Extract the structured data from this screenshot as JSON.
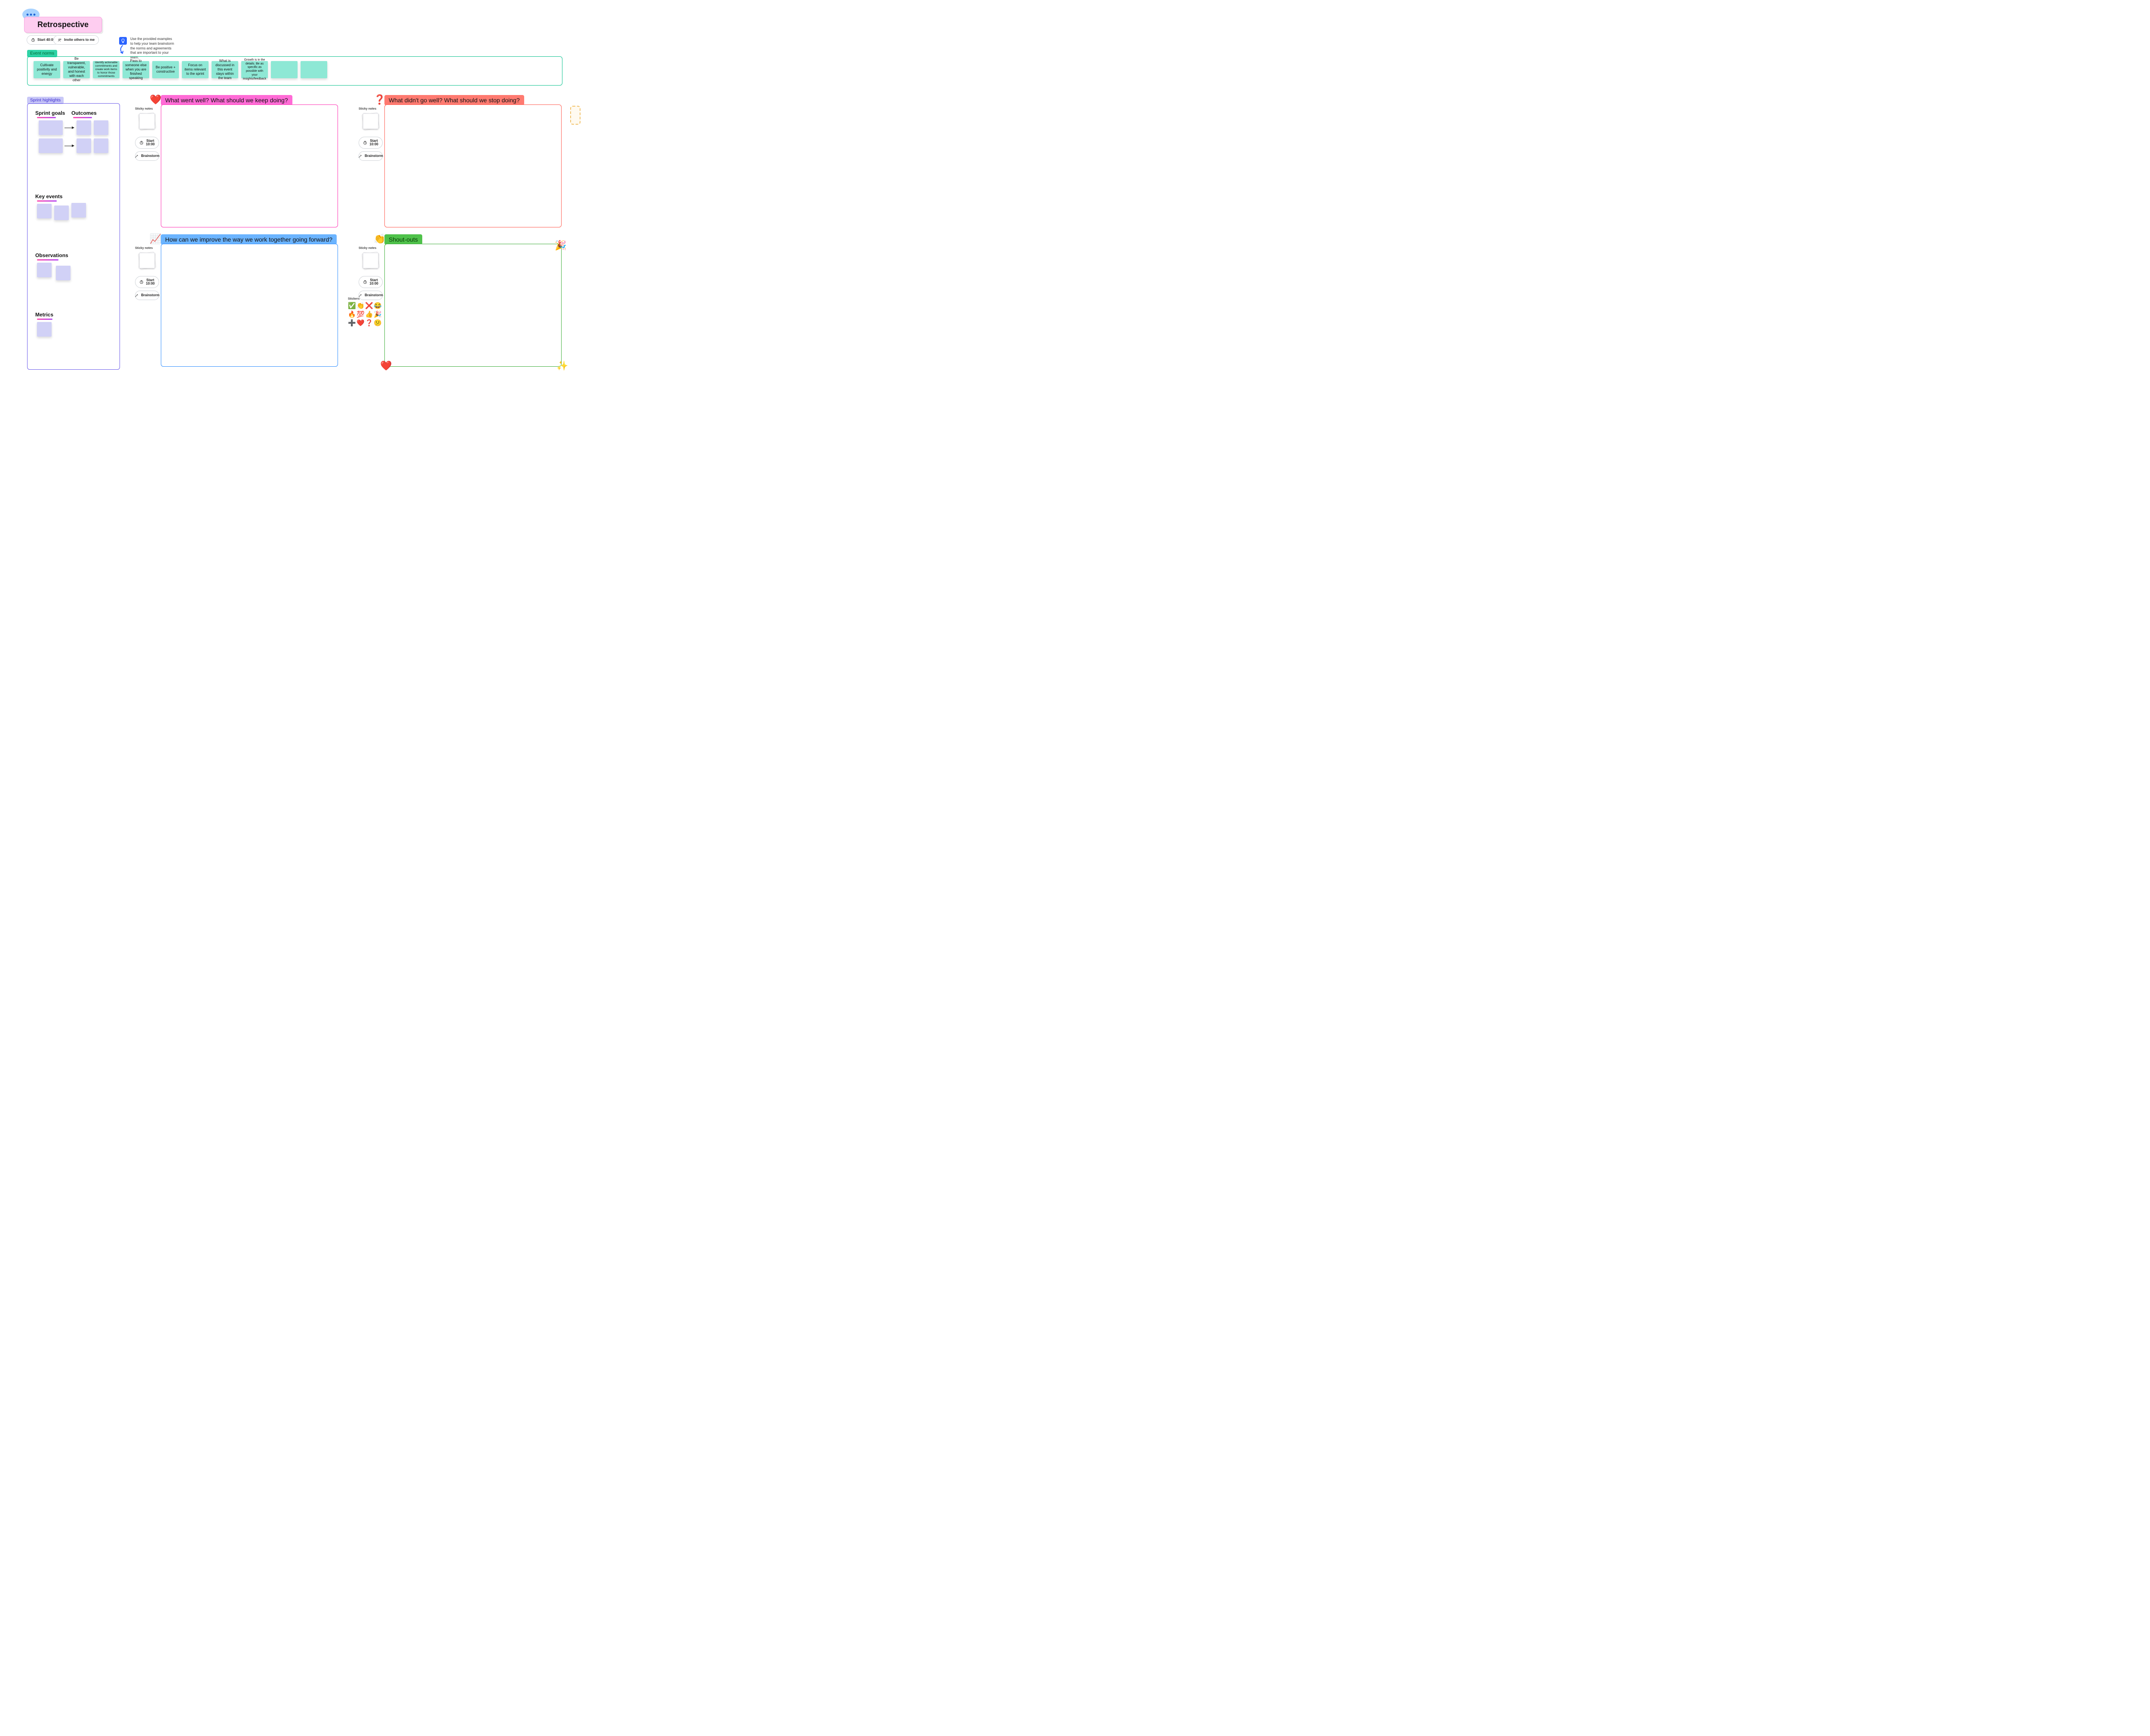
{
  "header": {
    "title": "Retrospective",
    "start_timer_label": "Start 40:00",
    "invite_label": "Invite others to me"
  },
  "tip": {
    "text": "Use the provided examples to help your team brainstorm the norms and agreements that are important to your team."
  },
  "event_norms": {
    "tag": "Event norms",
    "notes": [
      "Cultivate positivity and energy",
      "Be transparent, vulnerable, and honest with each other",
      "Identify actionable commitments and create work items to honor those commitments",
      "Pass to someone else when you are finished speaking",
      "Be positive + constructive",
      "Focus on items relevant to the sprint",
      "What is discussed in this event stays within the team",
      "Growth is in the details. Be as specific as possible with your insights/feedback",
      "",
      ""
    ]
  },
  "sprint_highlights": {
    "tag": "Sprint highlights",
    "goals_title": "Sprint goals",
    "outcomes_title": "Outcomes",
    "key_events_title": "Key events",
    "observations_title": "Observations",
    "metrics_title": "Metrics"
  },
  "sections": {
    "went_well": {
      "icon": "❤️",
      "title": "What went well? What should we keep doing?"
    },
    "not_well": {
      "icon": "❓",
      "title": "What didn't go well? What should we stop doing?"
    },
    "improve": {
      "icon": "📈",
      "title": "How can we improve the way we work together going forward?"
    },
    "shoutouts": {
      "icon": "👏",
      "title": "Shout-outs"
    }
  },
  "tools": {
    "sticky_notes_label": "Sticky notes",
    "start_timer_label": "Start 10:00",
    "brainstorm_label": "Brainstorm",
    "stickers_label": "Stickers"
  },
  "stickers": [
    "✅",
    "👏",
    "❌",
    "😂",
    "🔥",
    "💯",
    "👍",
    "🎉",
    "➕",
    "❤️",
    "❓",
    "😕"
  ]
}
